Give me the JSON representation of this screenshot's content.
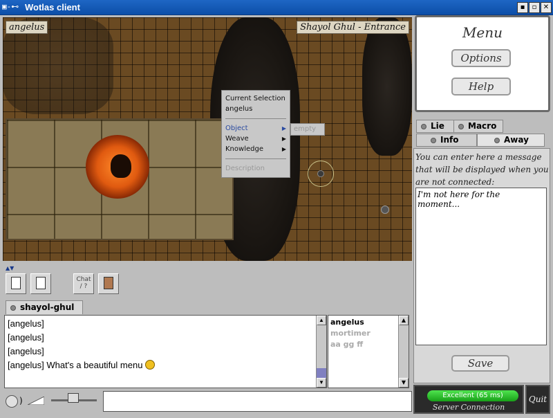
{
  "window": {
    "title": "Wotlas client",
    "controls": [
      "▪",
      "▫",
      "✕"
    ]
  },
  "game": {
    "player_tag": "angelus",
    "location_tag": "Shayol Ghul - Entrance",
    "context_menu": {
      "header": "Current Selection :",
      "selection": "angelus",
      "items": [
        {
          "label": "Object",
          "has_submenu": true,
          "highlighted": true
        },
        {
          "label": "Weave",
          "has_submenu": true,
          "highlighted": false
        },
        {
          "label": "Knowledge",
          "has_submenu": true,
          "highlighted": false
        }
      ],
      "footer": "Description",
      "submenu": "empty"
    }
  },
  "toolbar": {
    "chat_label": "Chat",
    "chat_sub": "/ ?"
  },
  "channel": {
    "tab_label": "shayol-ghul"
  },
  "chat": {
    "lines": [
      "[angelus]",
      "[angelus]",
      "[angelus]",
      "[angelus] What's a beautiful menu"
    ]
  },
  "users": [
    {
      "name": "angelus",
      "online": true
    },
    {
      "name": "mortimer",
      "online": false
    },
    {
      "name": "aa gg ff",
      "online": false
    }
  ],
  "input": {
    "value": ""
  },
  "menu_panel": {
    "title": "Menu",
    "options_label": "Options",
    "help_label": "Help"
  },
  "tabs": {
    "lie": "Lie",
    "macro": "Macro",
    "info": "Info",
    "away": "Away",
    "active": "Away"
  },
  "away_panel": {
    "message": "You can enter here a message that will be displayed when you are not connected:",
    "text": "I'm not here for the moment...",
    "save_label": "Save"
  },
  "connection": {
    "status": "Excellent (65 ms)",
    "label": "Server Connection",
    "status_color": "#2ac42a"
  },
  "quit_label": "Quit"
}
